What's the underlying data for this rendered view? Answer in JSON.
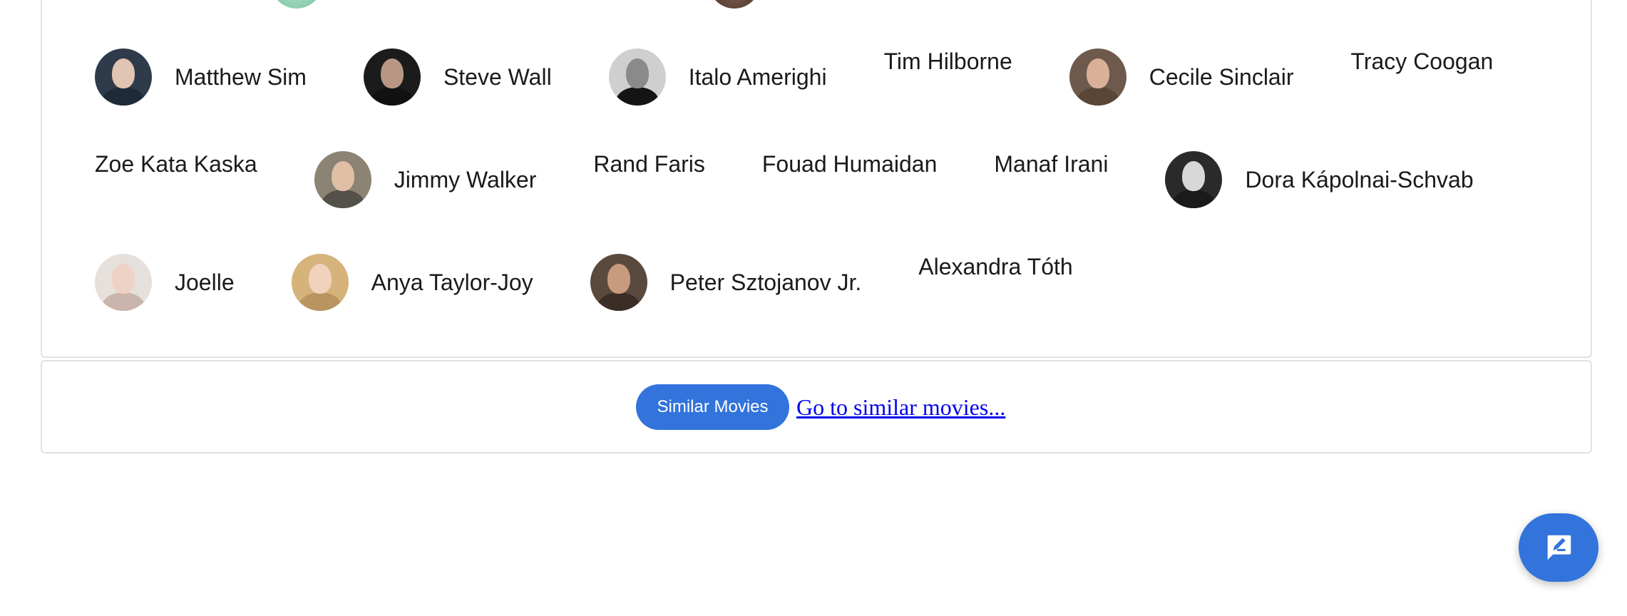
{
  "cast": {
    "rows": [
      [
        {
          "name": "Matthew Sim",
          "photo": true
        },
        {
          "name": "Steve Wall",
          "photo": true
        },
        {
          "name": "Italo Amerighi",
          "photo": true
        },
        {
          "name": "Tim Hilborne",
          "photo": false
        },
        {
          "name": "Cecile Sinclair",
          "photo": true
        },
        {
          "name": "Tracy Coogan",
          "photo": false
        }
      ],
      [
        {
          "name": "Zoe Kata Kaska",
          "photo": false
        },
        {
          "name": "Jimmy Walker",
          "photo": true
        },
        {
          "name": "Rand Faris",
          "photo": false
        },
        {
          "name": "Fouad Humaidan",
          "photo": false
        },
        {
          "name": "Manaf Irani",
          "photo": false
        },
        {
          "name": "Dora Kápolnai-Schvab",
          "photo": true
        }
      ],
      [
        {
          "name": "Joelle",
          "photo": true
        },
        {
          "name": "Anya Taylor-Joy",
          "photo": true
        },
        {
          "name": "Peter Sztojanov Jr.",
          "photo": true
        },
        {
          "name": "Alexandra Tóth",
          "photo": false
        }
      ]
    ]
  },
  "similar": {
    "button_label": "Similar Movies",
    "link_text": "Go to similar movies..."
  },
  "feedback": {
    "icon": "feedback-icon"
  },
  "colors": {
    "accent": "#3273dc",
    "link": "#0000ee",
    "border": "#e1e1e1"
  }
}
